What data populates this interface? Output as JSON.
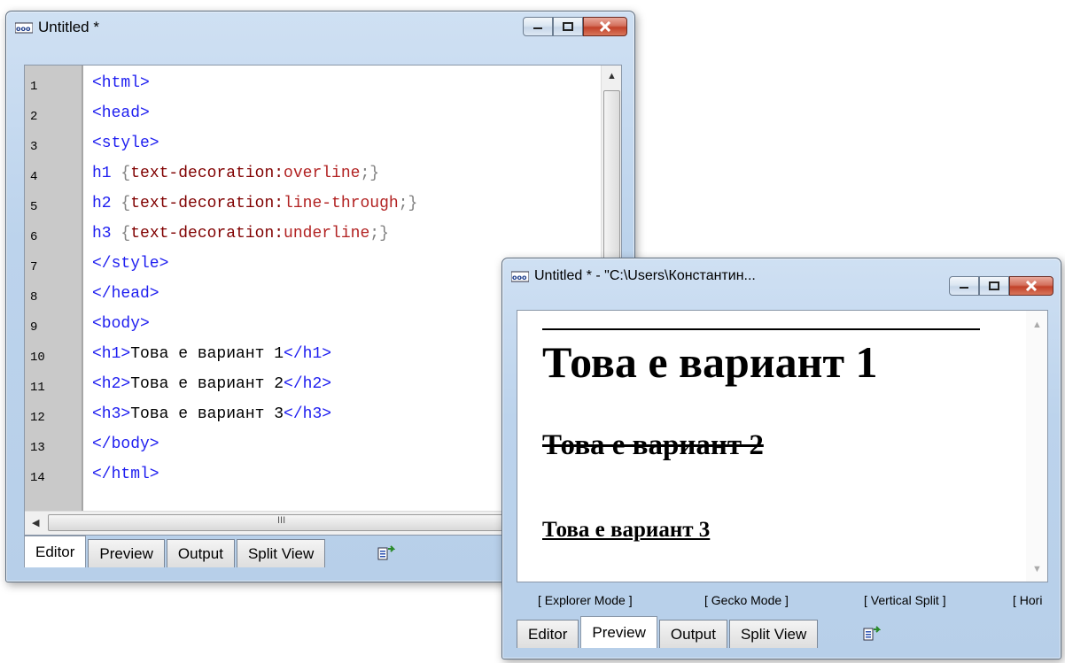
{
  "editor_window": {
    "title": "Untitled *",
    "line_numbers": [
      "1",
      "2",
      "3",
      "4",
      "5",
      "6",
      "7",
      "8",
      "9",
      "10",
      "11",
      "12",
      "13",
      "14"
    ],
    "code": {
      "l1": "<html>",
      "l2": "<head>",
      "l3": "<style>",
      "l4_sel": "h1",
      "l4_open": " {",
      "l4_prop": "text-decoration:",
      "l4_val": "overline",
      "l4_close": ";}",
      "l5_sel": "h2",
      "l5_open": " {",
      "l5_prop": "text-decoration:",
      "l5_val": "line-through",
      "l5_close": ";}",
      "l6_sel": "h3",
      "l6_open": " {",
      "l6_prop": "text-decoration:",
      "l6_val": "underline",
      "l6_close": ";}",
      "l7": "</style>",
      "l8": "</head>",
      "l9": "<body>",
      "l10_open": "<h1>",
      "l10_text": "Това е вариант 1",
      "l10_close": "</h1>",
      "l11_open": "<h2>",
      "l11_text": "Това е вариант 2",
      "l11_close": "</h2>",
      "l12_open": "<h3>",
      "l12_text": "Това е вариант 3",
      "l12_close": "</h3>",
      "l13": "</body>",
      "l14": "</html>"
    },
    "hscroll_grip": "III",
    "tabs": [
      "Editor",
      "Preview",
      "Output",
      "Split View"
    ],
    "active_tab": "Editor"
  },
  "preview_window": {
    "title": "Untitled * - \"C:\\Users\\Константин...",
    "h1": "Това е вариант 1",
    "h2": "Това е вариант 2",
    "h3": "Това е вариант 3",
    "modes": [
      "[ Explorer Mode ]",
      "[ Gecko Mode ]",
      "[ Vertical Split ]",
      "[ Hori"
    ],
    "tabs": [
      "Editor",
      "Preview",
      "Output",
      "Split View"
    ],
    "active_tab": "Preview"
  },
  "colors": {
    "tag": "#1e1ef0",
    "css_property": "#800000",
    "css_value": "#b22222",
    "punctuation": "#808080",
    "close_button": "#c2412a"
  },
  "icons": [
    "app-icon",
    "minimize-icon",
    "maximize-icon",
    "close-icon",
    "sync-view-icon",
    "scroll-up-icon",
    "scroll-down-icon",
    "scroll-left-icon",
    "scroll-right-icon"
  ]
}
